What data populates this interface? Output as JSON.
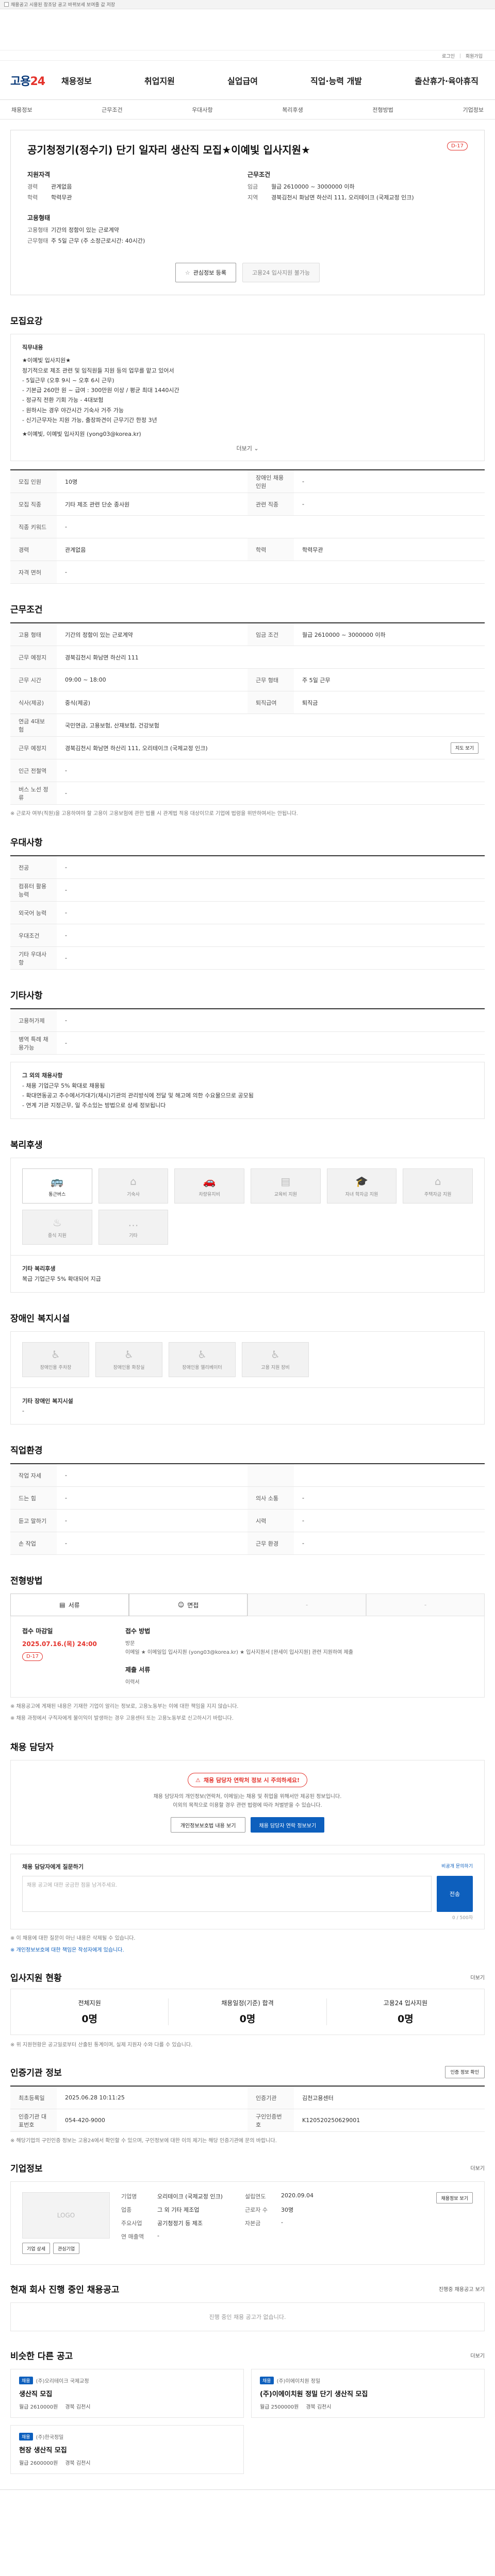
{
  "top_note": "채용공고 시용된 창조당 공고 바뀌보세 보여줄 값 저장",
  "util_links": [
    "로그인",
    "회원가입"
  ],
  "nav": {
    "logo_a": "고용",
    "logo_b": "24",
    "menus": [
      "채용정보",
      "취업지원",
      "실업급여",
      "직업·능력 개발",
      "출산휴가·육아휴직"
    ]
  },
  "subnav": [
    "채용정보",
    "근무조건",
    "우대사항",
    "복리후생",
    "전형방법",
    "기업정보"
  ],
  "job": {
    "title": "공기청정기(정수기) 단기 일자리 생산직 모집★이예빛 입사지원★",
    "dday": "D-17",
    "left_head": "지원자격",
    "left": [
      {
        "k": "경력",
        "v": "관계없음"
      },
      {
        "k": "학력",
        "v": "학력무관"
      }
    ],
    "left2_head": "고용형태",
    "left2": [
      {
        "k": "고용형태",
        "v": "기간의 정함이 있는 근로계약"
      },
      {
        "k": "근무형태",
        "v": "주 5일 근무 (주 소정근로시간: 40시간)"
      }
    ],
    "right_head": "근무조건",
    "right": [
      {
        "k": "임금",
        "v": "월급 2610000 ~ 3000000 이하"
      },
      {
        "k": "지역",
        "v": "경북김천시 화남면 하산리 111, 오리테이크 (국제교정 인크)"
      }
    ],
    "btn_like": "관심정보 등록",
    "btn_apply": "고용24 입사지원 불가능"
  },
  "req": {
    "head": "모집요강",
    "body_title": "직무내용",
    "body": [
      "★이예빛 입사지원★",
      "정기적으로 제조 관련 및 임직원들 지원 등의 업무를 맡고 있어서",
      "- 5일근무 (오후 9시 ~ 오후 6시 근무)",
      "- 기본급 260만 원 ~ 급여 : 300만원 이상 / 평균 최대 1440시간",
      "- 정규직 전환 기회 가능 - 4대보험",
      "- 원하시는 경우 야간시간 기숙사 거주 가능",
      "- 신기근무자는 지원 가능, 출장파견이 근무기간 한정 3년",
      "",
      "★이예빛, 이예빛 입사지원 (yong03@korea.kr)"
    ],
    "more": "더보기",
    "rows": [
      [
        {
          "k": "모집 인원",
          "v": "10명"
        },
        {
          "k": "장애인 채용 인원",
          "v": "-"
        }
      ],
      [
        {
          "k": "모집 직종",
          "v": "기타 제조 관련 단순 종사원"
        },
        {
          "k": "관련 직종",
          "v": "-"
        }
      ],
      [
        {
          "k": "직종 키워드",
          "v": "-"
        }
      ],
      [
        {
          "k": "경력",
          "v": "관계없음"
        },
        {
          "k": "학력",
          "v": "학력무관"
        }
      ],
      [
        {
          "k": "자격 면허",
          "v": "-"
        }
      ]
    ]
  },
  "work": {
    "head": "근무조건",
    "rows": [
      [
        {
          "k": "고용 형태",
          "v": "기간의 정함이 있는 근로계약"
        },
        {
          "k": "임금 조건",
          "v": "월급 2610000 ~ 3000000 이하"
        }
      ],
      [
        {
          "k": "근무 예정지",
          "v": "경북김천시 화남면 하산리 111"
        }
      ],
      [
        {
          "k": "근무 시간",
          "v": "09:00 ~ 18:00"
        },
        {
          "k": "근무 형태",
          "v": "주 5일 근무"
        }
      ],
      [
        {
          "k": "식사(제공)",
          "v": "중식(제공)"
        },
        {
          "k": "퇴직급여",
          "v": "퇴직금"
        }
      ],
      [
        {
          "k": "연금 4대보험",
          "v": "국민연금, 고용보험, 산재보험, 건강보험"
        }
      ],
      [
        {
          "k": "근무 예정지",
          "v": "경북김천시 화남면 하산리 111, 오리테이크 (국제교정 인크)"
        }
      ],
      [
        {
          "k": "인근 전철역",
          "v": "-"
        }
      ],
      [
        {
          "k": "버스 노선 정류",
          "v": "-"
        }
      ]
    ],
    "map_btn": "지도 보기",
    "note": "※ 근로자 여부(직원)을 고용하여야 할 고용이 고용보험에 관한 법률 시 관계법 적용 대상이므로 기업에 법령을 위반하여서는 안됩니다."
  },
  "pref": {
    "head": "우대사항",
    "rows": [
      {
        "k": "전공",
        "v": "-"
      },
      {
        "k": "컴퓨터 활용 능력",
        "v": "-"
      },
      {
        "k": "외국어 능력",
        "v": "-"
      },
      {
        "k": "우대조건",
        "v": "-"
      },
      {
        "k": "기타 우대사항",
        "v": "-"
      }
    ]
  },
  "etc": {
    "head": "기타사항",
    "rows": [
      {
        "k": "고용허가제",
        "v": "-"
      },
      {
        "k": "병역 특례 채용가능",
        "v": "-"
      }
    ],
    "box_title": "그 외의 채용사항",
    "box": [
      "- 채용 기업근무 5% 확대로 채용됨",
      "- 확대연동공고 추수에서가대기(채시)기관의 관리방식에 전달 및 해고에 의한 수요물으므로 공모됨",
      "- 연계 기관 지정근무, 일 주소있는 방법으로 상세 정보됩니다"
    ]
  },
  "welfare": {
    "head": "복리후생",
    "cards": [
      {
        "label": "통근버스",
        "icon": "bus-icon",
        "on": true
      },
      {
        "label": "기숙사",
        "icon": "home-icon",
        "on": false
      },
      {
        "label": "차량유지비",
        "icon": "car-icon",
        "on": false
      },
      {
        "label": "교육비 지원",
        "icon": "book-icon",
        "on": false
      },
      {
        "label": "자녀 학자금 지원",
        "icon": "cap-icon",
        "on": false
      },
      {
        "label": "주택자금 지원",
        "icon": "house-icon",
        "on": false
      },
      {
        "label": "중식 지원",
        "icon": "meal-icon",
        "on": false
      },
      {
        "label": "기타",
        "icon": "etc-icon",
        "on": false
      }
    ],
    "extra_title": "기타 복리후생",
    "extra": "복급 기업근무 5% 확대되어 지급"
  },
  "disability": {
    "head": "장애인 복지시설",
    "cards": [
      "장애인용 주차장",
      "장애인용 화장실",
      "장애인용 엘리베이터",
      "고용 지원 장비"
    ],
    "extra": "기타 장애인 복지시설",
    "extra_v": "-"
  },
  "career": {
    "head": "직업환경",
    "rows": [
      [
        {
          "k": "작업 자세",
          "v": "-"
        },
        {
          "k": "",
          "v": ""
        }
      ],
      [
        {
          "k": "드는 힘",
          "v": "-"
        },
        {
          "k": "의사 소통",
          "v": "-"
        }
      ],
      [
        {
          "k": "듣고 말하기",
          "v": "-"
        },
        {
          "k": "시력",
          "v": "-"
        }
      ],
      [
        {
          "k": "손 작업",
          "v": "-"
        },
        {
          "k": "근무 환경",
          "v": "-"
        }
      ]
    ]
  },
  "process": {
    "head": "전형방법",
    "tabs": [
      "서류",
      "면접",
      "-",
      "-"
    ],
    "deadline_k": "접수 마감일",
    "deadline": "2025.07.16.(목) 24:00",
    "deadline_dday": "D-17",
    "method_k": "접수 방법",
    "method": "방문\n이메일 ★ 이메일입 입사지원 (yong03@korea.kr) ★ 입사지원서 [완세이 입사지원] 관련 지원하여 제출",
    "docs_k": "제출 서류",
    "docs": "이력서",
    "notes": [
      "※ 채용공고에 게재된 내용은 기재한 기업이 알리는 정보로, 고용노동부는 이에 대한 책임을 지지 않습니다.",
      "※ 채용 과정에서 구직자에게 불이익이 발생하는 경우 고용센터 또는 고용노동부로 신고하시기 바랍니다."
    ]
  },
  "contact": {
    "head": "채용 담당자",
    "banner": "채용 담당자 연락처 정보 시 주의하세요!",
    "banner_sub": "채용 담당자의 개인정보(연락처, 이메일)는 채용 및 취업을 위해서만 제공된 정보입니다.\n이외의 목적으로 이용할 경우 관련 법령에 따라 처벌받을 수 있습니다.",
    "btn1": "개인정보보호법 내용 보기",
    "btn2": "채용 담당자 연락 정보보기",
    "form_title": "채용 담당자에게 질문하기",
    "form_link": "비공개 문의하기",
    "placeholder": "채용 공고에 대한 궁금한 점을 남겨주세요.",
    "count": "0 / 500자",
    "send": "전송",
    "notes": [
      "※ 이 채용에 대한 질문이 아닌 내용은 삭제될 수 있습니다.",
      "※ 개인정보보호에 대한 책임은 작성자에게 있습니다."
    ]
  },
  "apply": {
    "head": "입사지원 현황",
    "more": "더보기",
    "stats": [
      {
        "k": "전체지원",
        "v": "0명"
      },
      {
        "k": "채용일정(기준) 합격",
        "v": "0명"
      },
      {
        "k": "고용24 입사지원",
        "v": "0명"
      }
    ],
    "note": "※ 위 지원현황은 공고일로부터 산출된 통계이며, 실제 지원자 수와 다를 수 있습니다."
  },
  "hire": {
    "head": "인증기관 정보",
    "btn": "인증 정보 확인",
    "rows": [
      [
        {
          "k": "최초등록일",
          "v": "2025.06.28 10:11:25"
        },
        {
          "k": "인증기관",
          "v": "김천고용센터"
        }
      ],
      [
        {
          "k": "인증기관 대표번호",
          "v": "054-420-9000"
        },
        {
          "k": "구인인증번호",
          "v": "K120520250629001"
        }
      ]
    ],
    "note": "※ 해당기업의 구인인증 정보는 고용24에서 확인할 수 있으며, 구인정보에 대한 이의 제기는 해당 인증기관에 문의 바랍니다."
  },
  "company": {
    "head": "기업정보",
    "more": "더보기",
    "logo": "LOGO",
    "rows": [
      [
        {
          "k": "기업명",
          "v": "오리테이크 (국제교정 인크)"
        },
        {
          "k": "설립연도",
          "v": "2020.09.04"
        }
      ],
      [
        {
          "k": "업종",
          "v": "그 외 기타 제조업"
        },
        {
          "k": "근로자 수",
          "v": "30명"
        }
      ],
      [
        {
          "k": "주요사업",
          "v": "공기청정기 등 제조"
        },
        {
          "k": "자본금",
          "v": "-"
        }
      ],
      [
        {
          "k": "연 매출액",
          "v": "-"
        },
        {
          "k": "",
          "v": ""
        }
      ]
    ],
    "btn_a": "기업 상세",
    "btn_b": "관심기업",
    "btn_c": "채용정보 보기"
  },
  "others": {
    "head": "현재 회사 진행 중인 채용공고",
    "more": "진행중 채용공고 보기",
    "empty": "진행 중인 채용 공고가 없습니다."
  },
  "similar": {
    "head": "비슷한 다른 공고",
    "more": "더보기",
    "items": [
      {
        "badge": "채용",
        "company": "(주)오리테이크 국제교정",
        "title": "생산직 모집",
        "pay": "월급 2610000원",
        "loc": "경북 김천시"
      },
      {
        "badge": "채용",
        "company": "(주)이에이치원 정밀",
        "title": "(주)이에이치원 정밀 단기 생산직 모집",
        "pay": "월급 2500000원",
        "loc": "경북 김천시"
      },
      {
        "badge": "채용",
        "company": "(주)한국정밀",
        "title": "현장 생산직 모집",
        "pay": "월급 2600000원",
        "loc": "경북 김천시"
      }
    ]
  },
  "colors": {
    "accent": "#0d5fbd",
    "red": "#e4322b",
    "navy": "#0a3a7a"
  }
}
